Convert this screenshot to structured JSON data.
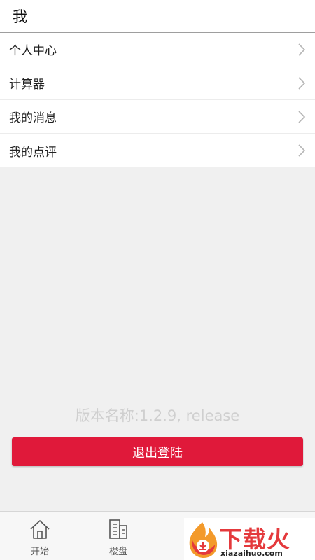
{
  "header": {
    "title": "我"
  },
  "menu": {
    "items": [
      {
        "label": "个人中心",
        "icon": "chevron-right-icon"
      },
      {
        "label": "计算器",
        "icon": "chevron-right-icon"
      },
      {
        "label": "我的消息",
        "icon": "chevron-right-icon"
      },
      {
        "label": "我的点评",
        "icon": "chevron-right-icon"
      }
    ]
  },
  "version": {
    "text": "版本名称:1.2.9, release"
  },
  "logout": {
    "label": "退出登陆"
  },
  "tabbar": {
    "tabs": [
      {
        "label": "开始",
        "icon": "home-icon"
      },
      {
        "label": "楼盘",
        "icon": "building-icon"
      }
    ]
  },
  "watermark": {
    "brand": "下载火",
    "site": "xiazaihuo.com",
    "icon": "fire-logo-icon"
  },
  "colors": {
    "accent": "#e0193a",
    "watermark_red": "#e4393c",
    "watermark_orange": "#f39a2b"
  }
}
